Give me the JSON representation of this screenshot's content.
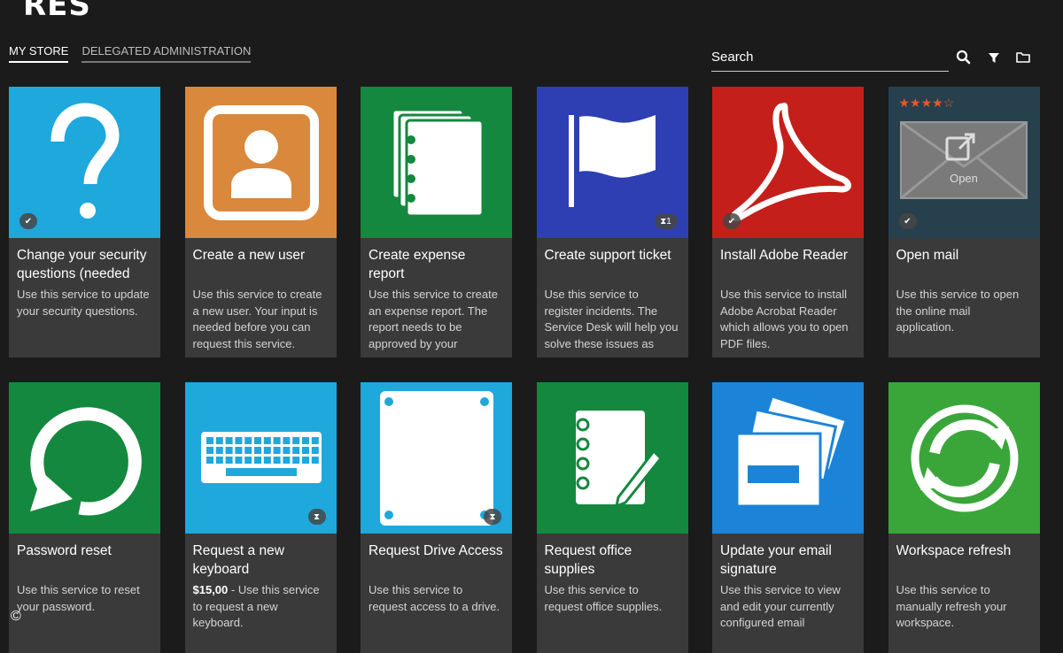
{
  "logo": "RES",
  "tabs": [
    {
      "label": "MY STORE"
    },
    {
      "label": "DELEGATED ADMINISTRATION"
    }
  ],
  "search": {
    "placeholder": "Search"
  },
  "cards": [
    {
      "title": "Change your security questions (needed",
      "desc": "Use this service to update your security questions.",
      "color": "#1ea8dc",
      "icon": "question-mark-icon"
    },
    {
      "title": "Create a new user",
      "desc": "Use this service to create a new user. Your input is needed before you can request this service.",
      "color": "#d9883c",
      "icon": "user-icon"
    },
    {
      "title": "Create expense report",
      "desc": "Use this service to create an expense report. The report needs to be approved by your",
      "color": "#14883e",
      "icon": "documents-icon"
    },
    {
      "title": "Create support ticket",
      "desc": "Use this service to register incidents. The Service Desk will help you solve these issues as",
      "color": "#2e3fb4",
      "icon": "flag-icon",
      "badge": "1"
    },
    {
      "title": "Install Adobe Reader",
      "desc": "Use this service to install Adobe Acrobat Reader which allows you to open PDF files.",
      "color": "#c41f1a",
      "icon": "adobe-acrobat-icon"
    },
    {
      "title": "Open mail",
      "desc": "Use this service to open the online mail application.",
      "color": "#27404e",
      "icon": "mail-icon",
      "rating": "★★★★☆",
      "open_label": "Open"
    },
    {
      "title": "Password reset",
      "desc": "Use this service to reset your password.",
      "color": "#14883e",
      "icon": "refresh-arrow-icon"
    },
    {
      "title": "Request a new keyboard",
      "price": "$15,00",
      "desc": " - Use this service to request a new keyboard.",
      "color": "#1ea8dc",
      "icon": "keyboard-icon"
    },
    {
      "title": "Request Drive Access",
      "desc": "Use this service to request access to a drive.",
      "color": "#1ea8dc",
      "icon": "drive-icon"
    },
    {
      "title": "Request office supplies",
      "desc": "Use this service to request office supplies.",
      "color": "#14883e",
      "icon": "notebook-pen-icon"
    },
    {
      "title": "Update your email signature",
      "desc": "Use this service to view and edit your currently configured email",
      "color": "#1c84d8",
      "icon": "envelopes-icon"
    },
    {
      "title": "Workspace refresh",
      "desc": "Use this service to manually refresh your workspace.",
      "color": "#3aa63a",
      "icon": "sync-icon"
    }
  ],
  "copyright_symbol": "©"
}
